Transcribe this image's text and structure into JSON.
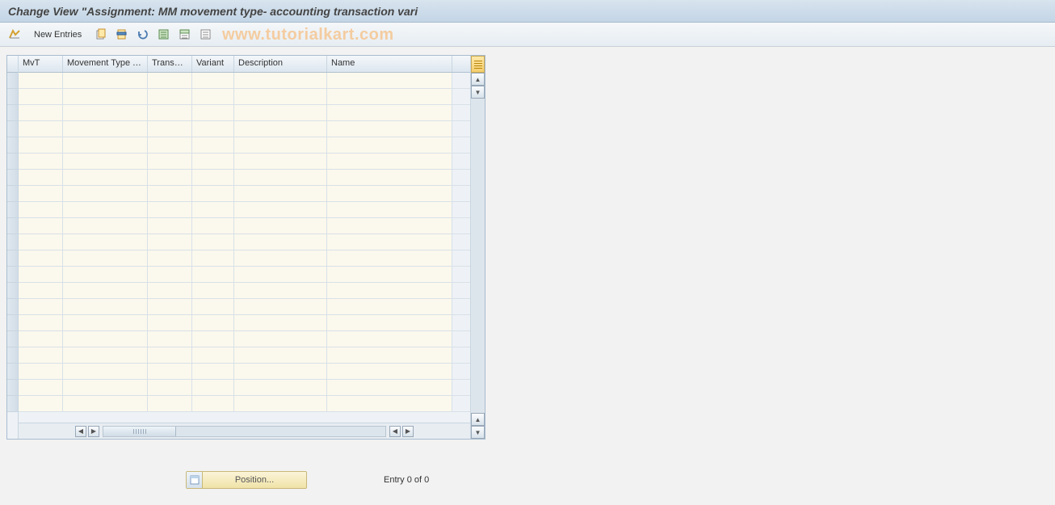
{
  "title": "Change View \"Assignment: MM movement type- accounting transaction vari",
  "toolbar": {
    "new_entries": "New Entries"
  },
  "watermark": "www.tutorialkart.com",
  "table": {
    "columns": {
      "mvt": "MvT",
      "mvtext": "Movement Type Text",
      "transac": "Transac...",
      "variant": "Variant",
      "desc": "Description",
      "name": "Name"
    },
    "row_count": 21
  },
  "footer": {
    "position_label": "Position...",
    "entry_text": "Entry 0 of 0"
  }
}
